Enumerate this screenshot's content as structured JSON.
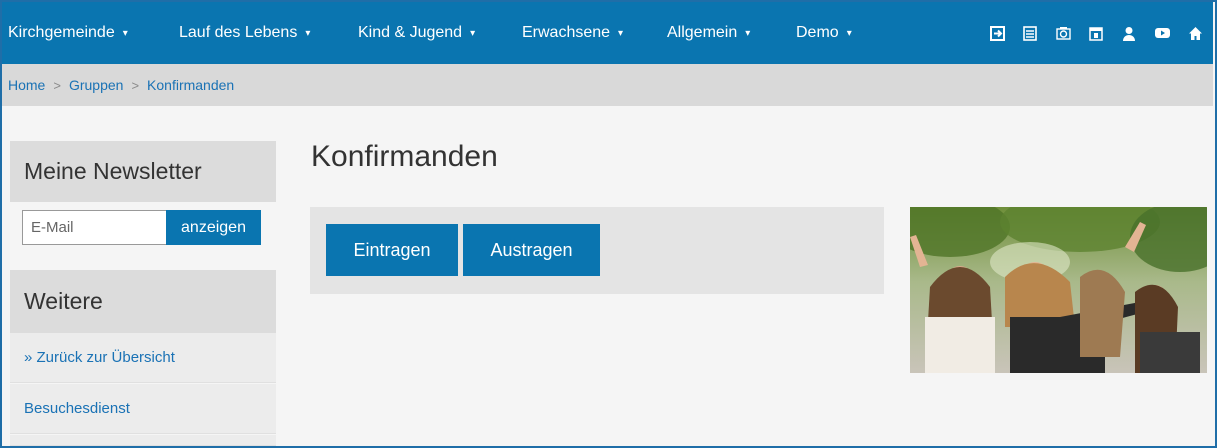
{
  "nav": {
    "items": [
      {
        "label": "Kirchgemeinde",
        "caret": "▾"
      },
      {
        "label": "Lauf des Lebens",
        "caret": "▾"
      },
      {
        "label": "Kind & Jugend",
        "caret": "▾"
      },
      {
        "label": "Erwachsene",
        "caret": "▾"
      },
      {
        "label": "Allgemein",
        "caret": "▾"
      },
      {
        "label": "Demo",
        "caret": "▾"
      }
    ],
    "icons": [
      "login-icon",
      "calendar-list-icon",
      "camera-icon",
      "calendar-icon",
      "user-icon",
      "youtube-icon",
      "home-icon"
    ]
  },
  "breadcrumb": {
    "items": [
      "Home",
      "Gruppen",
      "Konfirmanden"
    ],
    "separator": ">"
  },
  "sidebar": {
    "newsletter_title": "Meine Newsletter",
    "email_placeholder": "E-Mail",
    "show_label": "anzeigen",
    "more_title": "Weitere",
    "links": [
      "» Zurück zur Übersicht",
      "Besuchesdienst"
    ]
  },
  "main": {
    "title": "Konfirmanden",
    "subscribe_label": "Eintragen",
    "unsubscribe_label": "Austragen"
  },
  "colors": {
    "brand": "#0a75b0",
    "link": "#1a72b5"
  }
}
